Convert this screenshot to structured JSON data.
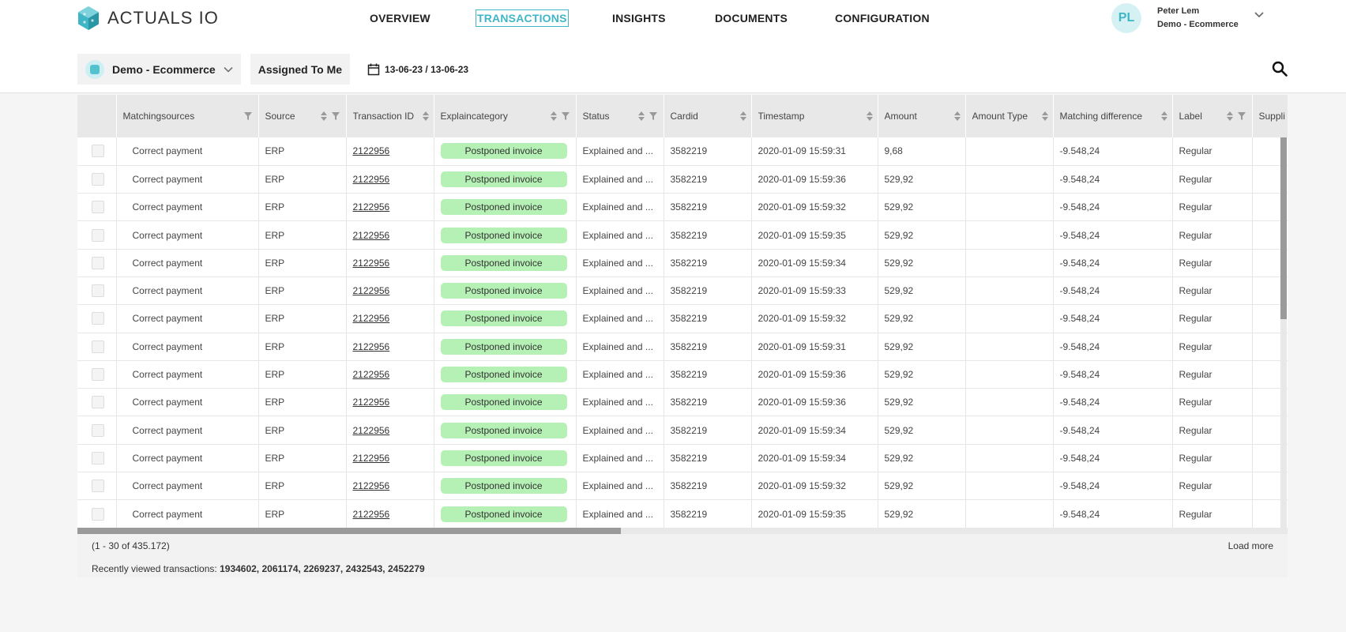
{
  "app": {
    "logo_text": "ACTUALS IO"
  },
  "nav": [
    {
      "label": "OVERVIEW",
      "active": false
    },
    {
      "label": "TRANSACTIONS",
      "active": true
    },
    {
      "label": "INSIGHTS",
      "active": false
    },
    {
      "label": "DOCUMENTS",
      "active": false
    },
    {
      "label": "CONFIGURATION",
      "active": false
    }
  ],
  "user": {
    "initials": "PL",
    "name": "Peter Lem",
    "company": "Demo - Ecommerce"
  },
  "filters": {
    "workspace": "Demo - Ecommerce",
    "assigned": "Assigned To Me",
    "date_range": "13-06-23 / 13-06-23"
  },
  "columns": [
    {
      "label": "Matchingsources",
      "sort": false,
      "filter": true
    },
    {
      "label": "Source",
      "sort": true,
      "filter": true
    },
    {
      "label": "Transaction ID",
      "sort": true,
      "filter": false
    },
    {
      "label": "Explaincategory",
      "sort": true,
      "filter": true
    },
    {
      "label": "Status",
      "sort": true,
      "filter": true
    },
    {
      "label": "Cardid",
      "sort": true,
      "filter": false
    },
    {
      "label": "Timestamp",
      "sort": true,
      "filter": false
    },
    {
      "label": "Amount",
      "sort": true,
      "filter": false
    },
    {
      "label": "Amount Type",
      "sort": true,
      "filter": false
    },
    {
      "label": "Matching difference",
      "sort": true,
      "filter": false
    },
    {
      "label": "Label",
      "sort": true,
      "filter": true
    },
    {
      "label": "Suppli",
      "sort": false,
      "filter": false
    }
  ],
  "rows": [
    {
      "matching": "Correct payment",
      "source": "ERP",
      "txid": "2122956",
      "category": "Postponed invoice",
      "status": "Explained and ...",
      "cardid": "3582219",
      "timestamp": "2020-01-09 15:59:31",
      "amount": "9,68",
      "amount_type": "",
      "diff": "-9.548,24",
      "label": "Regular"
    },
    {
      "matching": "Correct payment",
      "source": "ERP",
      "txid": "2122956",
      "category": "Postponed invoice",
      "status": "Explained and ...",
      "cardid": "3582219",
      "timestamp": "2020-01-09 15:59:36",
      "amount": "529,92",
      "amount_type": "",
      "diff": "-9.548,24",
      "label": "Regular"
    },
    {
      "matching": "Correct payment",
      "source": "ERP",
      "txid": "2122956",
      "category": "Postponed invoice",
      "status": "Explained and ...",
      "cardid": "3582219",
      "timestamp": "2020-01-09 15:59:32",
      "amount": "529,92",
      "amount_type": "",
      "diff": "-9.548,24",
      "label": "Regular"
    },
    {
      "matching": "Correct payment",
      "source": "ERP",
      "txid": "2122956",
      "category": "Postponed invoice",
      "status": "Explained and ...",
      "cardid": "3582219",
      "timestamp": "2020-01-09 15:59:35",
      "amount": "529,92",
      "amount_type": "",
      "diff": "-9.548,24",
      "label": "Regular"
    },
    {
      "matching": "Correct payment",
      "source": "ERP",
      "txid": "2122956",
      "category": "Postponed invoice",
      "status": "Explained and ...",
      "cardid": "3582219",
      "timestamp": "2020-01-09 15:59:34",
      "amount": "529,92",
      "amount_type": "",
      "diff": "-9.548,24",
      "label": "Regular"
    },
    {
      "matching": "Correct payment",
      "source": "ERP",
      "txid": "2122956",
      "category": "Postponed invoice",
      "status": "Explained and ...",
      "cardid": "3582219",
      "timestamp": "2020-01-09 15:59:33",
      "amount": "529,92",
      "amount_type": "",
      "diff": "-9.548,24",
      "label": "Regular"
    },
    {
      "matching": "Correct payment",
      "source": "ERP",
      "txid": "2122956",
      "category": "Postponed invoice",
      "status": "Explained and ...",
      "cardid": "3582219",
      "timestamp": "2020-01-09 15:59:32",
      "amount": "529,92",
      "amount_type": "",
      "diff": "-9.548,24",
      "label": "Regular"
    },
    {
      "matching": "Correct payment",
      "source": "ERP",
      "txid": "2122956",
      "category": "Postponed invoice",
      "status": "Explained and ...",
      "cardid": "3582219",
      "timestamp": "2020-01-09 15:59:31",
      "amount": "529,92",
      "amount_type": "",
      "diff": "-9.548,24",
      "label": "Regular"
    },
    {
      "matching": "Correct payment",
      "source": "ERP",
      "txid": "2122956",
      "category": "Postponed invoice",
      "status": "Explained and ...",
      "cardid": "3582219",
      "timestamp": "2020-01-09 15:59:36",
      "amount": "529,92",
      "amount_type": "",
      "diff": "-9.548,24",
      "label": "Regular"
    },
    {
      "matching": "Correct payment",
      "source": "ERP",
      "txid": "2122956",
      "category": "Postponed invoice",
      "status": "Explained and ...",
      "cardid": "3582219",
      "timestamp": "2020-01-09 15:59:36",
      "amount": "529,92",
      "amount_type": "",
      "diff": "-9.548,24",
      "label": "Regular"
    },
    {
      "matching": "Correct payment",
      "source": "ERP",
      "txid": "2122956",
      "category": "Postponed invoice",
      "status": "Explained and ...",
      "cardid": "3582219",
      "timestamp": "2020-01-09 15:59:34",
      "amount": "529,92",
      "amount_type": "",
      "diff": "-9.548,24",
      "label": "Regular"
    },
    {
      "matching": "Correct payment",
      "source": "ERP",
      "txid": "2122956",
      "category": "Postponed invoice",
      "status": "Explained and ...",
      "cardid": "3582219",
      "timestamp": "2020-01-09 15:59:34",
      "amount": "529,92",
      "amount_type": "",
      "diff": "-9.548,24",
      "label": "Regular"
    },
    {
      "matching": "Correct payment",
      "source": "ERP",
      "txid": "2122956",
      "category": "Postponed invoice",
      "status": "Explained and ...",
      "cardid": "3582219",
      "timestamp": "2020-01-09 15:59:32",
      "amount": "529,92",
      "amount_type": "",
      "diff": "-9.548,24",
      "label": "Regular"
    },
    {
      "matching": "Correct payment",
      "source": "ERP",
      "txid": "2122956",
      "category": "Postponed invoice",
      "status": "Explained and ...",
      "cardid": "3582219",
      "timestamp": "2020-01-09 15:59:35",
      "amount": "529,92",
      "amount_type": "",
      "diff": "-9.548,24",
      "label": "Regular"
    }
  ],
  "footer": {
    "range": "(1 - 30 of 435.172)",
    "load_more": "Load more",
    "recent_label": "Recently viewed transactions:",
    "recent_ids": "1934602, 2061174, 2269237, 2432543, 2452279"
  },
  "colors": {
    "accent": "#3fb6c6",
    "pill": "#b5f0b5"
  },
  "icons": {
    "search": "search-icon",
    "calendar": "calendar-icon",
    "chevron": "chevron-down-icon",
    "sort": "sort-icon",
    "filter": "filter-icon"
  }
}
